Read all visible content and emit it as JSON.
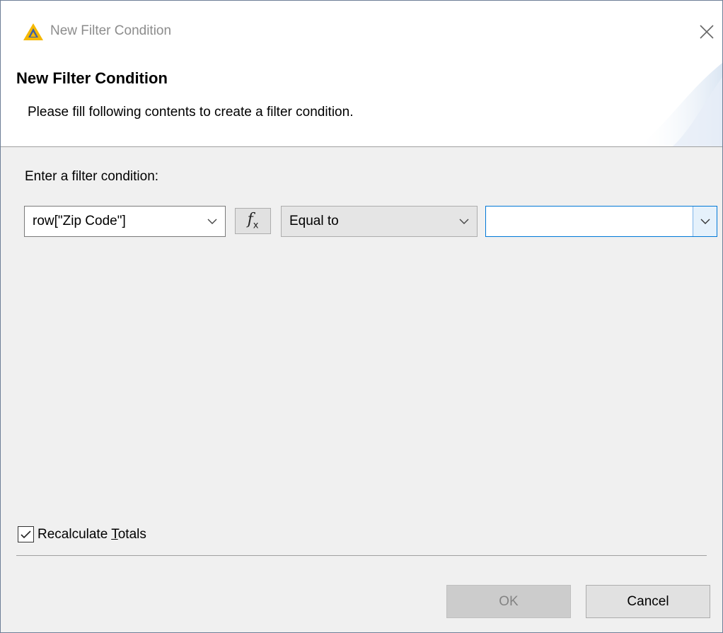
{
  "window": {
    "title": "New Filter Condition",
    "icons": {
      "logo": "birt-logo-icon",
      "close": "close-icon"
    }
  },
  "banner": {
    "heading": "New Filter Condition",
    "message": "Please fill following contents to create a filter condition."
  },
  "form": {
    "prompt": "Enter a filter condition:",
    "column_combo": {
      "value": "row[\"Zip Code\"]",
      "icon": "chevron-down-icon"
    },
    "expression_button": {
      "icon": "fx-function-icon",
      "glyph": "f",
      "subscript": "x"
    },
    "operator_combo": {
      "value": "Equal to",
      "icon": "chevron-down-icon"
    },
    "value_combo": {
      "value": "",
      "icon": "chevron-down-icon"
    }
  },
  "options": {
    "recalculate_totals": {
      "label_before": "Recalculate ",
      "mnemonic": "T",
      "label_after": "otals",
      "checked": true
    }
  },
  "buttons": {
    "ok": {
      "label": "OK",
      "enabled": false
    },
    "cancel": {
      "label": "Cancel",
      "enabled": true
    }
  },
  "colors": {
    "accent": "#0078d7",
    "logo": "#f5b800",
    "dialog_bg": "#f0f0f0"
  }
}
